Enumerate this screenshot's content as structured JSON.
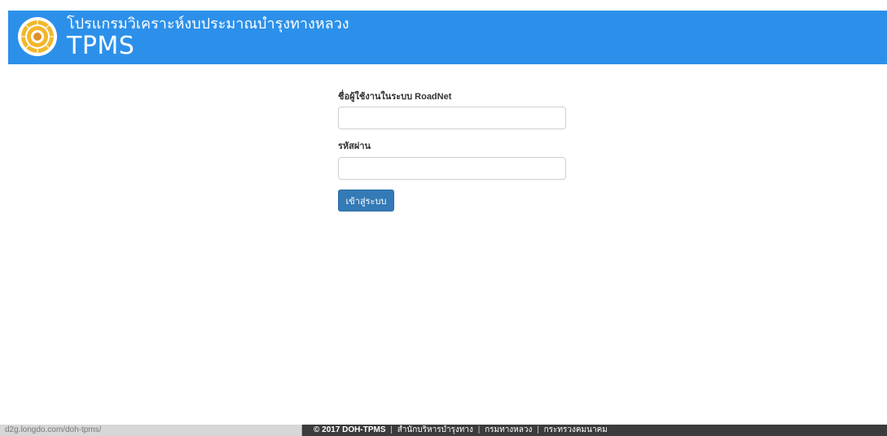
{
  "header": {
    "subtitle": "โปรแกรมวิเคราะห์งบประมาณบำรุงทางหลวง",
    "title": "TPMS",
    "logo_icon": "doh-emblem-icon"
  },
  "login": {
    "username_label": "ชื่อผู้ใช้งานในระบบ RoadNet",
    "username_value": "",
    "password_label": "รหัสผ่าน",
    "password_value": "",
    "submit_label": "เข้าสู่ระบบ"
  },
  "footer": {
    "status_url": "d2g.longdo.com/doh-tpms/",
    "copyright": "© 2017 DOH-TPMS",
    "sep1": "|",
    "link1": "สำนักบริหารบำรุงทาง",
    "sep2": "|",
    "link2": "กรมทางหลวง",
    "sep3": "|",
    "link3": "กระทรวงคมนาคม"
  },
  "colors": {
    "header_bg": "#2c90ea",
    "button_bg": "#337ab7",
    "footer_bg": "#3b3b3b"
  }
}
